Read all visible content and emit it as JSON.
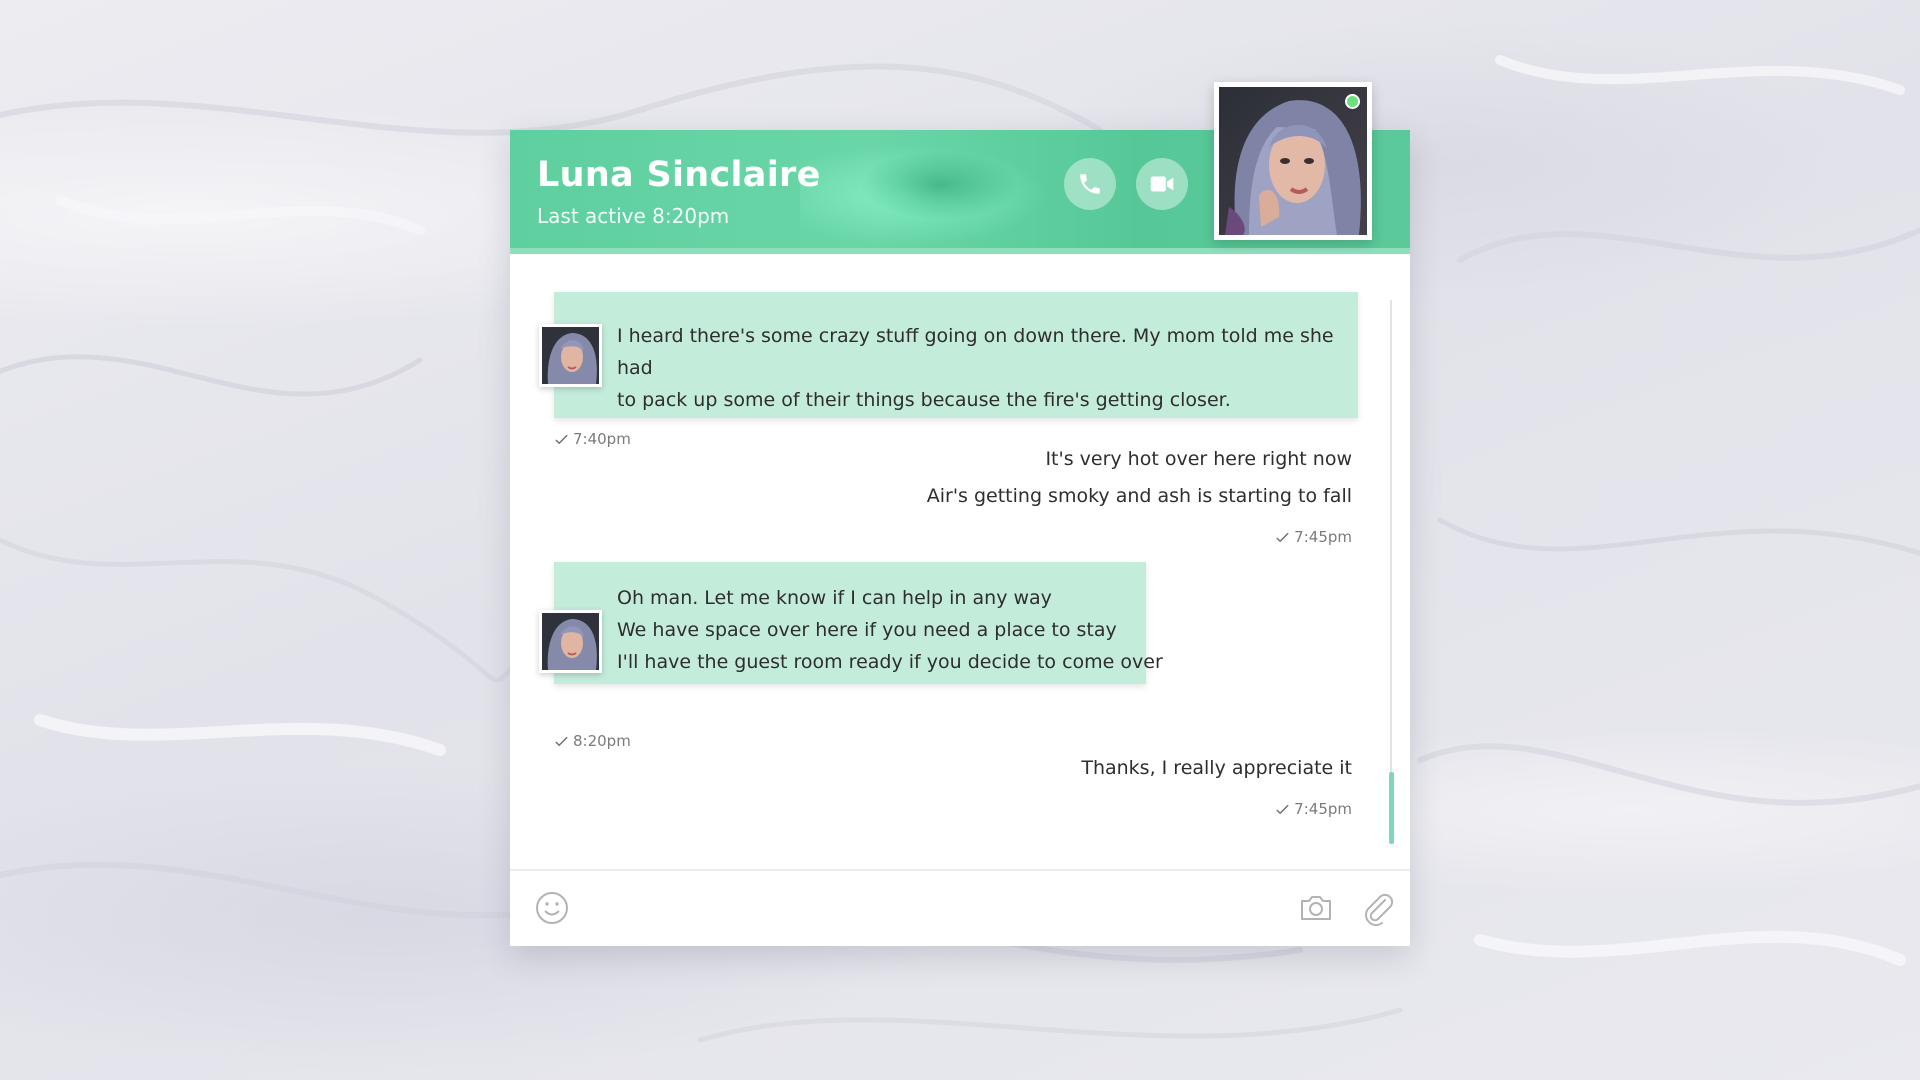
{
  "contact": {
    "name": "Luna Sinclaire",
    "status": "Last active 8:20pm",
    "online": true,
    "online_color": "#6de07a"
  },
  "header": {
    "call_icon": "phone-icon",
    "video_icon": "video-camera-icon"
  },
  "messages": [
    {
      "from": "contact",
      "lines": [
        "I heard there's some crazy stuff going on down there. My mom told me she had",
        "to pack up some of their things because the fire's getting closer."
      ],
      "time": "7:40pm"
    },
    {
      "from": "me",
      "lines": [
        "It's very hot over here right now",
        "Air's getting smoky and ash is starting to fall"
      ],
      "time": "7:45pm"
    },
    {
      "from": "contact",
      "lines": [
        "Oh man. Let me know if I can help in any way",
        "We have space over here if you need a place to stay",
        "I'll have the guest room ready if you decide to come over"
      ],
      "time": "8:20pm"
    },
    {
      "from": "me",
      "lines": [
        "Thanks, I really appreciate it"
      ],
      "time": "7:45pm"
    }
  ],
  "composer": {
    "emoji_icon": "smiley-icon",
    "camera_icon": "camera-icon",
    "attach_icon": "paperclip-icon"
  },
  "colors": {
    "accent": "#5fcf9f",
    "bubble": "#c4ecdb",
    "scroll_thumb": "#7fd8b4"
  }
}
